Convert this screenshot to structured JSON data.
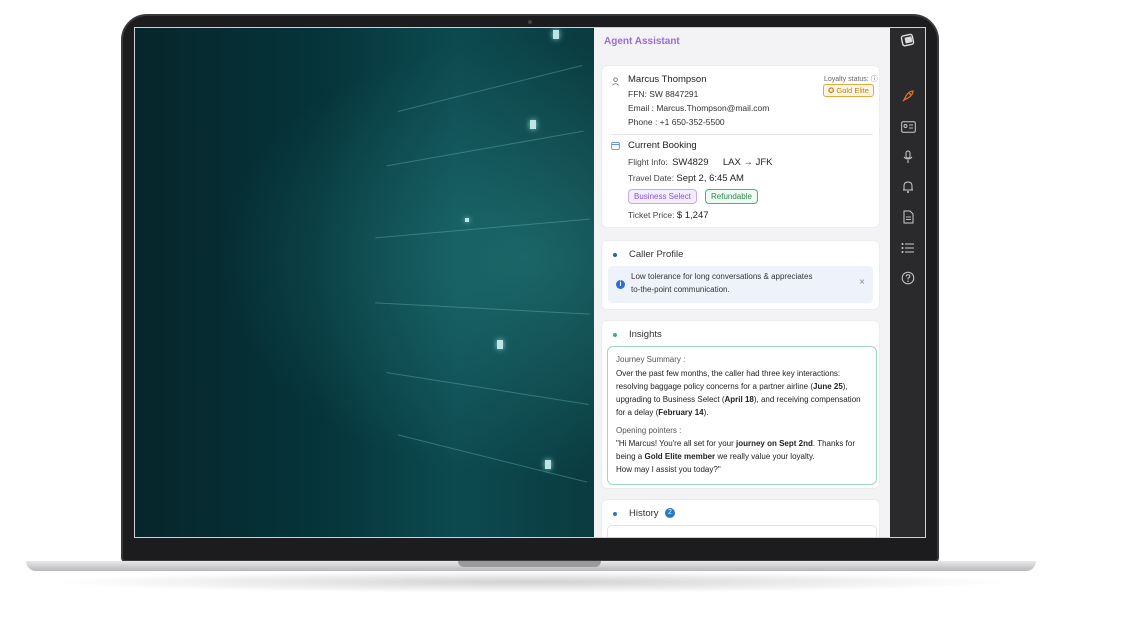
{
  "panel": {
    "title": "Agent Assistant"
  },
  "customer": {
    "name": "Marcus Thompson",
    "ffn": "FFN: SW 8847291",
    "email": "Email : Marcus.Thompson@mail.com",
    "phone": "Phone : +1 650-352-5500",
    "loyalty_label": "Loyalty status:",
    "loyalty_tier": "Gold Elite"
  },
  "booking": {
    "title": "Current Booking",
    "flight_label": "Flight Info:",
    "flight_number": "SW4829",
    "route": "LAX → JFK",
    "date_label": "Travel Date:",
    "date_value": "Sept 2, 6:45 AM",
    "tag_fare": "Business Select",
    "tag_refund": "Refundable",
    "price_label": "Ticket Price:",
    "price_value": "$ 1,247"
  },
  "caller_profile": {
    "title": "Caller Profile",
    "note_line1": "Low tolerance for long conversations  & appreciates",
    "note_line2": "to-the-point communication."
  },
  "insights": {
    "title": "Insights",
    "journey_label": "Journey Summary :",
    "journey_l1": "Over the past few months, the caller had three key interactions:",
    "journey_l2a": "resolving baggage policy concerns for a partner airline (",
    "journey_l2b": "June 25",
    "journey_l2c": "),",
    "journey_l3a": "upgrading to Business Select (",
    "journey_l3b": "April 18",
    "journey_l3c": "), and receiving compensation",
    "journey_l4a": "for a delay (",
    "journey_l4b": "February 14",
    "journey_l4c": ").",
    "opening_label": "Opening pointers :",
    "open_l1a": "\"Hi Marcus! You're all set for your ",
    "open_l1b": "journey on Sept 2nd",
    "open_l1c": ". Thanks for",
    "open_l2a": "being a ",
    "open_l2b": "Gold Elite member",
    "open_l2c": " we really value your loyalty.",
    "open_l3": "How may I assist you today?\""
  },
  "history": {
    "title": "History",
    "count": "2"
  },
  "sidebar": {
    "items": [
      "logo-icon",
      "rocket-icon",
      "id-card-icon",
      "microphone-icon",
      "bell-icon",
      "document-icon",
      "list-icon",
      "help-icon"
    ]
  },
  "colors": {
    "accent_purple": "#9a6bdc",
    "gold": "#e5a83a",
    "green": "#4db079",
    "sidebar_bg": "#2a2a2c",
    "rocket_orange": "#e8743b"
  }
}
